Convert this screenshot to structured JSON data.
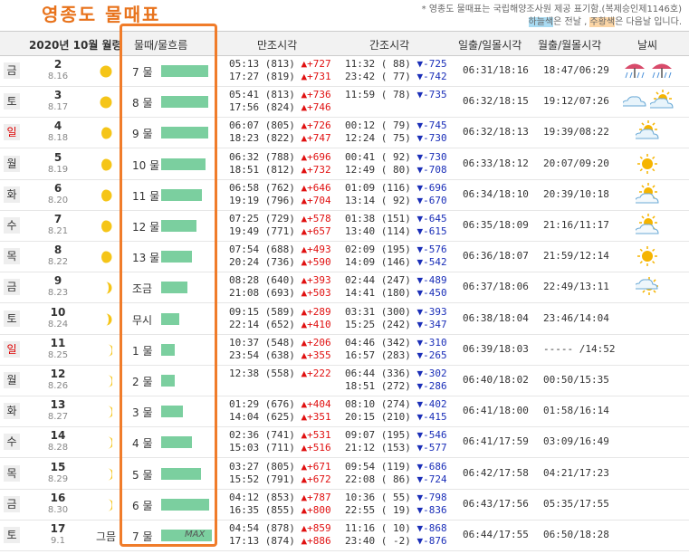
{
  "title": "영종도  물때표",
  "notice": {
    "line1": "* 영종도 물때표는 국립해양조사원 제공 표기함.(복제승인제1146호)",
    "line2_a": "하늘색",
    "line2_b": "은 전날 , ",
    "line2_c": "주황색",
    "line2_d": "은 다음날 입니다."
  },
  "header": {
    "month": "2020년  10월 월령",
    "tide": "물때/물흐름",
    "high": "만조시각",
    "low": "간조시각",
    "sun": "일출/일몰시각",
    "moonrise": "월출/월몰시각",
    "weather": "날씨"
  },
  "colors": {
    "bar": "#7bcf9f",
    "frame": "#f07c2a",
    "up": "#e01010",
    "down": "#1a2eb8",
    "title": "#e8731c"
  },
  "rows": [
    {
      "dow": "금",
      "red": false,
      "sday": "2",
      "lday": "8.16",
      "moon": "full",
      "tide": "7 물",
      "bar": 0.92,
      "h1": "05:13 (813)",
      "h1d": "▲+727",
      "h2": "17:27 (819)",
      "h2d": "▲+731",
      "l1": "11:32 ( 88)",
      "l1d": "▼-725",
      "l2": "23:42 ( 77)",
      "l2d": "▼-742",
      "sun": "06:31/18:16",
      "moonrise": "18:47/06:29",
      "wx": [
        "rain",
        "rain"
      ]
    },
    {
      "dow": "토",
      "red": false,
      "sday": "3",
      "lday": "8.17",
      "moon": "full",
      "tide": "8 물",
      "bar": 0.92,
      "h1": "05:41 (813)",
      "h1d": "▲+736",
      "h2": "17:56 (824)",
      "h2d": "▲+746",
      "l1": "11:59 ( 78)",
      "l1d": "▼-735",
      "l2": "",
      "l2d": "",
      "sun": "06:32/18:15",
      "moonrise": "19:12/07:26",
      "wx": [
        "cloud",
        "sun-cloud"
      ]
    },
    {
      "dow": "일",
      "red": true,
      "sday": "4",
      "lday": "8.18",
      "moon": "waning",
      "tide": "9 물",
      "bar": 0.92,
      "h1": "06:07 (805)",
      "h1d": "▲+726",
      "h2": "18:23 (822)",
      "h2d": "▲+747",
      "l1": "00:12 ( 79)",
      "l1d": "▼-745",
      "l2": "12:24 ( 75)",
      "l2d": "▼-730",
      "sun": "06:32/18:13",
      "moonrise": "19:39/08:22",
      "wx": [
        "sun-cloud"
      ]
    },
    {
      "dow": "월",
      "red": false,
      "sday": "5",
      "lday": "8.19",
      "moon": "waning",
      "tide": "10 물",
      "bar": 0.88,
      "h1": "06:32 (788)",
      "h1d": "▲+696",
      "h2": "18:51 (812)",
      "h2d": "▲+732",
      "l1": "00:41 ( 92)",
      "l1d": "▼-730",
      "l2": "12:49 ( 80)",
      "l2d": "▼-708",
      "sun": "06:33/18:12",
      "moonrise": "20:07/09:20",
      "wx": [
        "sun"
      ]
    },
    {
      "dow": "화",
      "red": false,
      "sday": "6",
      "lday": "8.20",
      "moon": "waning",
      "tide": "11 물",
      "bar": 0.8,
      "h1": "06:58 (762)",
      "h1d": "▲+646",
      "h2": "19:19 (796)",
      "h2d": "▲+704",
      "l1": "01:09 (116)",
      "l1d": "▼-696",
      "l2": "13:14 ( 92)",
      "l2d": "▼-670",
      "sun": "06:34/18:10",
      "moonrise": "20:39/10:18",
      "wx": [
        "sun-cloud-light"
      ]
    },
    {
      "dow": "수",
      "red": false,
      "sday": "7",
      "lday": "8.21",
      "moon": "waning",
      "tide": "12 물",
      "bar": 0.7,
      "h1": "07:25 (729)",
      "h1d": "▲+578",
      "h2": "19:49 (771)",
      "h2d": "▲+657",
      "l1": "01:38 (151)",
      "l1d": "▼-645",
      "l2": "13:40 (114)",
      "l2d": "▼-615",
      "sun": "06:35/18:09",
      "moonrise": "21:16/11:17",
      "wx": [
        "sun-cloud-light"
      ]
    },
    {
      "dow": "목",
      "red": false,
      "sday": "8",
      "lday": "8.22",
      "moon": "waning",
      "tide": "13 물",
      "bar": 0.6,
      "h1": "07:54 (688)",
      "h1d": "▲+493",
      "h2": "20:24 (736)",
      "h2d": "▲+590",
      "l1": "02:09 (195)",
      "l1d": "▼-576",
      "l2": "14:09 (146)",
      "l2d": "▼-542",
      "sun": "06:36/18:07",
      "moonrise": "21:59/12:14",
      "wx": [
        "sun"
      ]
    },
    {
      "dow": "금",
      "red": false,
      "sday": "9",
      "lday": "8.23",
      "moon": "quarter",
      "tide": "조금",
      "bar": 0.52,
      "h1": "08:28 (640)",
      "h1d": "▲+393",
      "h2": "21:08 (693)",
      "h2d": "▲+503",
      "l1": "02:44 (247)",
      "l1d": "▼-489",
      "l2": "14:41 (180)",
      "l2d": "▼-450",
      "sun": "06:37/18:06",
      "moonrise": "22:49/13:11",
      "wx": [
        "sun-cloud-small"
      ]
    },
    {
      "dow": "토",
      "red": false,
      "sday": "10",
      "lday": "8.24",
      "moon": "quarter",
      "tide": "무시",
      "bar": 0.36,
      "h1": "09:15 (589)",
      "h1d": "▲+289",
      "h2": "22:14 (652)",
      "h2d": "▲+410",
      "l1": "03:31 (300)",
      "l1d": "▼-393",
      "l2": "15:25 (242)",
      "l2d": "▼-347",
      "sun": "06:38/18:04",
      "moonrise": "23:46/14:04",
      "wx": []
    },
    {
      "dow": "일",
      "red": true,
      "sday": "11",
      "lday": "8.25",
      "moon": "crescent",
      "tide": "1 물",
      "bar": 0.26,
      "h1": "10:37 (548)",
      "h1d": "▲+206",
      "h2": "23:54 (638)",
      "h2d": "▲+355",
      "l1": "04:46 (342)",
      "l1d": "▼-310",
      "l2": "16:57 (283)",
      "l2d": "▼-265",
      "sun": "06:39/18:03",
      "moonrise": "----- /14:52",
      "wx": []
    },
    {
      "dow": "월",
      "red": false,
      "sday": "12",
      "lday": "8.26",
      "moon": "crescent",
      "tide": "2 물",
      "bar": 0.26,
      "h1": "12:38 (558)",
      "h1d": "▲+222",
      "h2": "",
      "h2d": "",
      "l1": "06:44 (336)",
      "l1d": "▼-302",
      "l2": "18:51 (272)",
      "l2d": "▼-286",
      "sun": "06:40/18:02",
      "moonrise": "00:50/15:35",
      "wx": []
    },
    {
      "dow": "화",
      "red": false,
      "sday": "13",
      "lday": "8.27",
      "moon": "crescent",
      "tide": "3 물",
      "bar": 0.43,
      "h1": "01:29 (676)",
      "h1d": "▲+404",
      "h2": "14:04 (625)",
      "h2d": "▲+351",
      "l1": "08:10 (274)",
      "l1d": "▼-402",
      "l2": "20:15 (210)",
      "l2d": "▼-415",
      "sun": "06:41/18:00",
      "moonrise": "01:58/16:14",
      "wx": []
    },
    {
      "dow": "수",
      "red": false,
      "sday": "14",
      "lday": "8.28",
      "moon": "crescent",
      "tide": "4 물",
      "bar": 0.6,
      "h1": "02:36 (741)",
      "h1d": "▲+531",
      "h2": "15:03 (711)",
      "h2d": "▲+516",
      "l1": "09:07 (195)",
      "l1d": "▼-546",
      "l2": "21:12 (153)",
      "l2d": "▼-577",
      "sun": "06:41/17:59",
      "moonrise": "03:09/16:49",
      "wx": []
    },
    {
      "dow": "목",
      "red": false,
      "sday": "15",
      "lday": "8.29",
      "moon": "crescent",
      "tide": "5 물",
      "bar": 0.78,
      "h1": "03:27 (805)",
      "h1d": "▲+671",
      "h2": "15:52 (791)",
      "h2d": "▲+672",
      "l1": "09:54 (119)",
      "l1d": "▼-686",
      "l2": "22:08 ( 86)",
      "l2d": "▼-724",
      "sun": "06:42/17:58",
      "moonrise": "04:21/17:23",
      "wx": []
    },
    {
      "dow": "금",
      "red": false,
      "sday": "16",
      "lday": "8.30",
      "moon": "crescent",
      "tide": "6 물",
      "bar": 0.94,
      "h1": "04:12 (853)",
      "h1d": "▲+787",
      "h2": "16:35 (855)",
      "h2d": "▲+800",
      "l1": "10:36 ( 55)",
      "l1d": "▼-798",
      "l2": "22:55 ( 19)",
      "l2d": "▼-836",
      "sun": "06:43/17:56",
      "moonrise": "05:35/17:55",
      "wx": []
    },
    {
      "dow": "토",
      "red": false,
      "sday": "17",
      "lday": "9.1",
      "moon": "new",
      "moonlabel": "그믐",
      "tide": "7 물",
      "bar": 1.0,
      "bartext": "MAX",
      "h1": "04:54 (878)",
      "h1d": "▲+859",
      "h2": "17:13 (874)",
      "h2d": "▲+886",
      "l1": "11:16 ( 10)",
      "l1d": "▼-868",
      "l2": "23:40 ( -2)",
      "l2d": "▼-876",
      "sun": "06:44/17:55",
      "moonrise": "06:50/18:28",
      "wx": []
    }
  ]
}
